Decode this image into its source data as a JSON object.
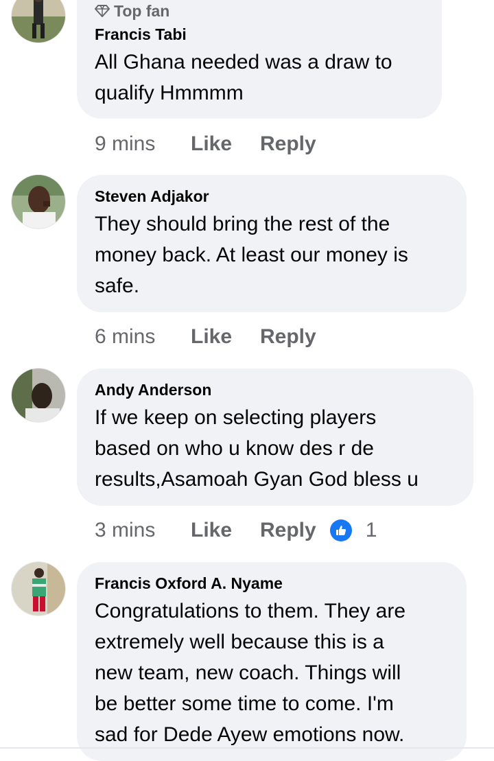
{
  "comments": [
    {
      "top_fan_label": "Top fan",
      "author": "Francis Tabi",
      "text": "All Ghana needed was a draw to\nqualify Hmmmm",
      "time": "9 mins",
      "like_label": "Like",
      "reply_label": "Reply"
    },
    {
      "author": "Steven Adjakor",
      "text": "They should bring the rest of the\nmoney back. At least our money is\nsafe.",
      "time": "6 mins",
      "like_label": "Like",
      "reply_label": "Reply"
    },
    {
      "author": "Andy Anderson",
      "text": "If we keep on selecting players\nbased on who u know des r de\nresults,Asamoah Gyan God bless u",
      "time": "3 mins",
      "like_label": "Like",
      "reply_label": "Reply",
      "reaction_icon": "like-thumb-icon",
      "reaction_count": "1"
    },
    {
      "author": "Francis Oxford A. Nyame",
      "text": "Congratulations to them. They are\nextremely well because this is a\nnew team, new coach. Things will\nbe better some time to come. I'm\nsad for Dede Ayew emotions now."
    }
  ],
  "colors": {
    "bubble": "#f0f2f5",
    "secondary_text": "#65676b",
    "reaction_blue": "#1877f2"
  }
}
